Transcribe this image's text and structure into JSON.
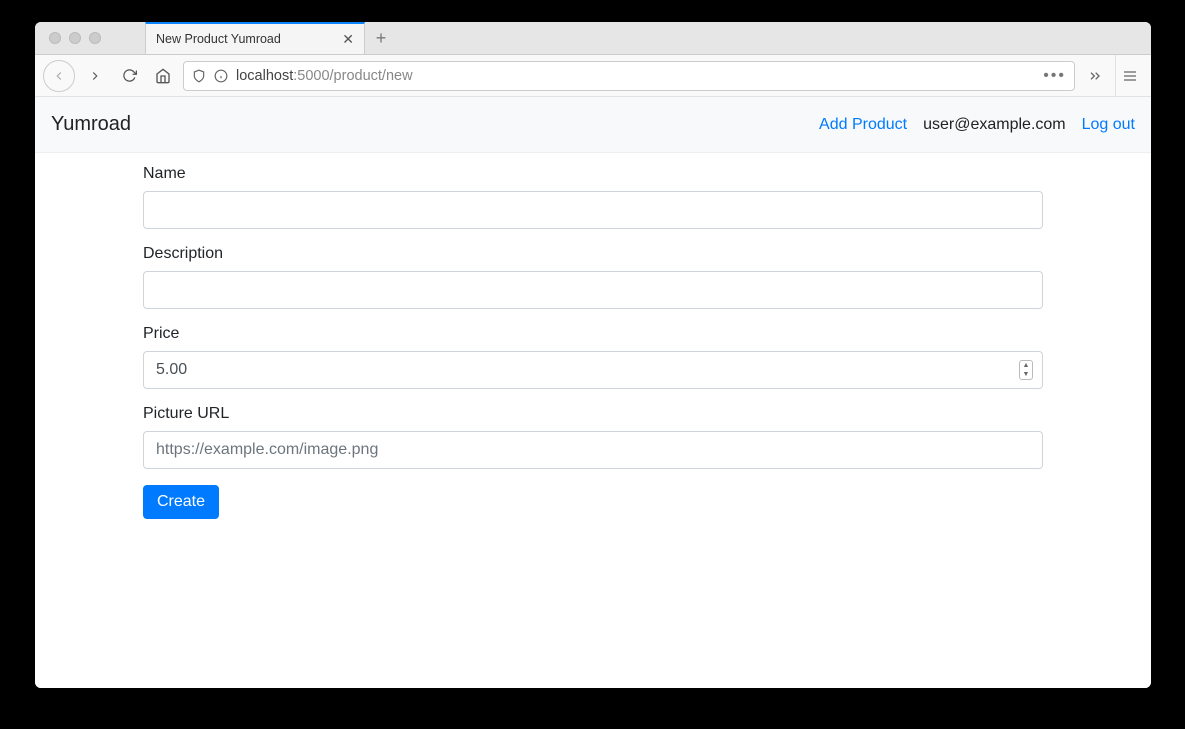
{
  "browser": {
    "tab_title": "New Product Yumroad",
    "url_display_host": "localhost",
    "url_display_path": ":5000/product/new"
  },
  "navbar": {
    "brand": "Yumroad",
    "add_product": "Add Product",
    "user_email": "user@example.com",
    "logout": "Log out"
  },
  "form": {
    "name_label": "Name",
    "name_value": "",
    "description_label": "Description",
    "description_value": "",
    "price_label": "Price",
    "price_value": "5.00",
    "picture_label": "Picture URL",
    "picture_placeholder": "https://example.com/image.png",
    "picture_value": "",
    "submit_label": "Create"
  }
}
